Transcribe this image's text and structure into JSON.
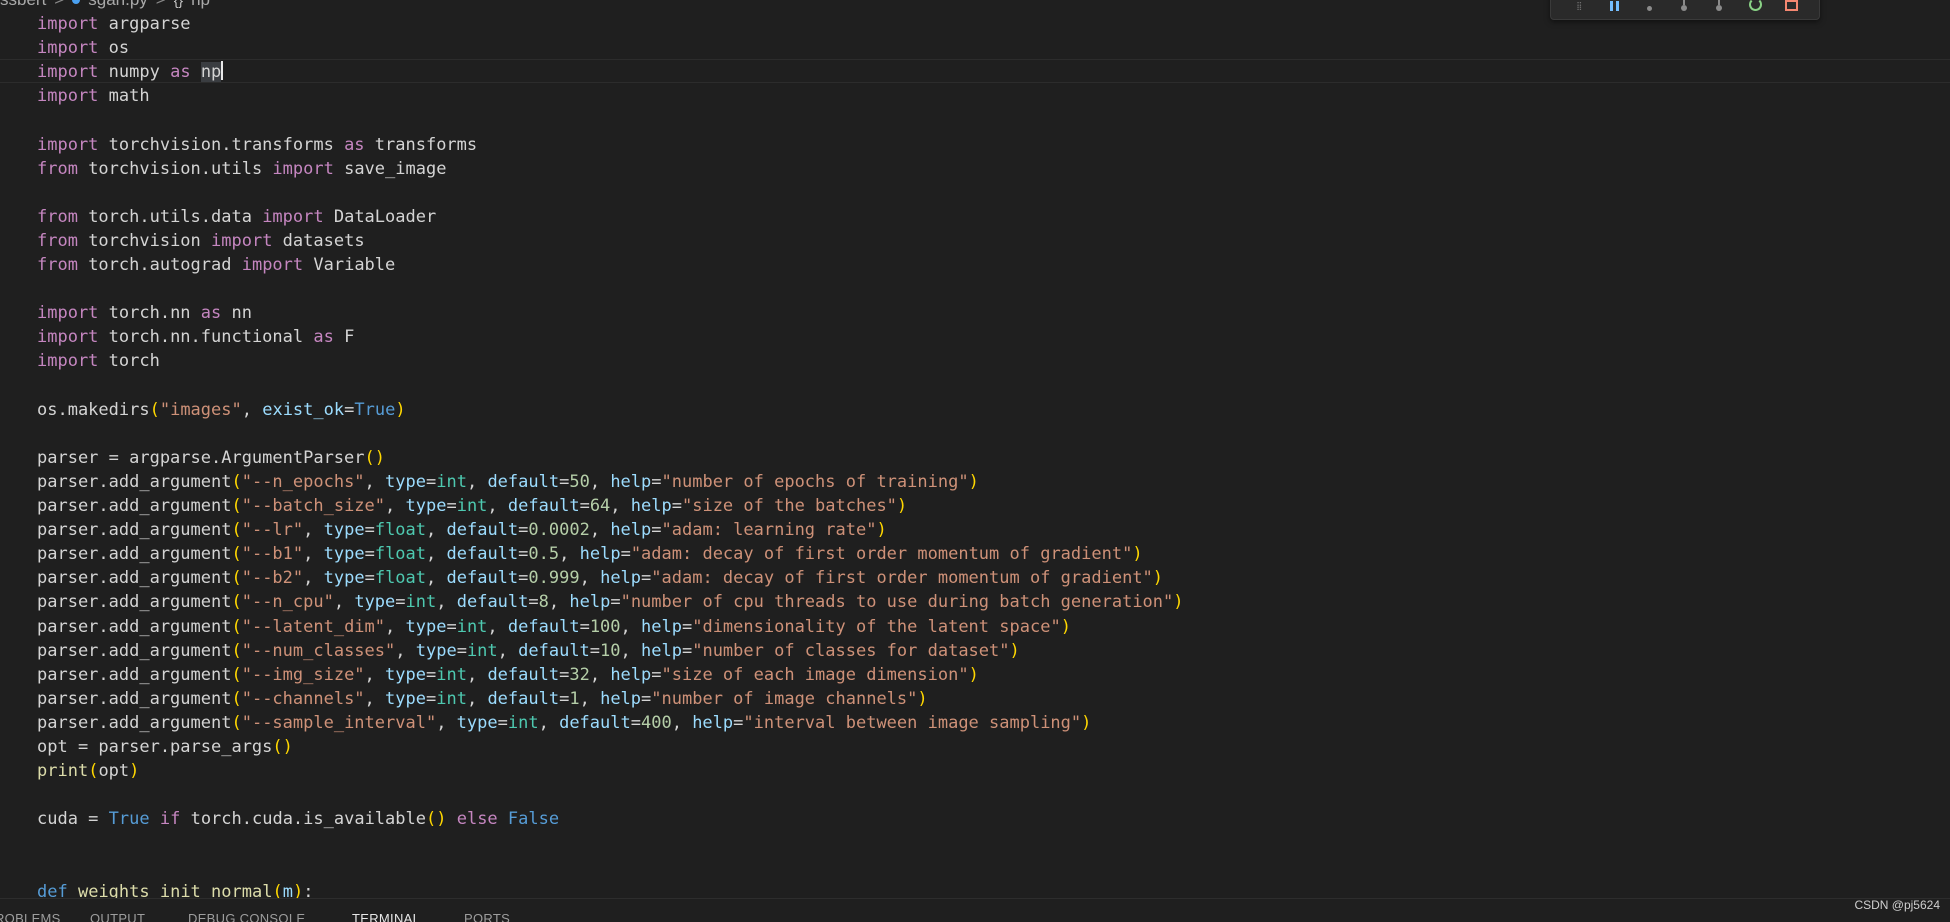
{
  "breadcrumb": {
    "folder": "ssbert",
    "file": "sgan.py",
    "symbol_icon": "{}",
    "symbol": "np",
    "separator": ">"
  },
  "debug_toolbar": {
    "buttons": [
      "drag-handle",
      "pause",
      "step-over",
      "step-into",
      "step-out",
      "restart",
      "stop"
    ]
  },
  "code_lines": [
    [
      [
        "kw",
        "import"
      ],
      [
        "plain",
        " argparse"
      ]
    ],
    [
      [
        "kw",
        "import"
      ],
      [
        "plain",
        " os"
      ]
    ],
    [
      [
        "kw",
        "import"
      ],
      [
        "plain",
        " numpy "
      ],
      [
        "kw",
        "as"
      ],
      [
        "plain",
        " "
      ],
      [
        "sel",
        "np"
      ],
      [
        "cursor",
        ""
      ]
    ],
    [
      [
        "kw",
        "import"
      ],
      [
        "plain",
        " math"
      ]
    ],
    [],
    [
      [
        "kw",
        "import"
      ],
      [
        "plain",
        " torchvision.transforms "
      ],
      [
        "kw",
        "as"
      ],
      [
        "plain",
        " transforms"
      ]
    ],
    [
      [
        "kw",
        "from"
      ],
      [
        "plain",
        " torchvision.utils "
      ],
      [
        "kw",
        "import"
      ],
      [
        "plain",
        " save_image"
      ]
    ],
    [],
    [
      [
        "kw",
        "from"
      ],
      [
        "plain",
        " torch.utils.data "
      ],
      [
        "kw",
        "import"
      ],
      [
        "plain",
        " DataLoader"
      ]
    ],
    [
      [
        "kw",
        "from"
      ],
      [
        "plain",
        " torchvision "
      ],
      [
        "kw",
        "import"
      ],
      [
        "plain",
        " datasets"
      ]
    ],
    [
      [
        "kw",
        "from"
      ],
      [
        "plain",
        " torch.autograd "
      ],
      [
        "kw",
        "import"
      ],
      [
        "plain",
        " Variable"
      ]
    ],
    [],
    [
      [
        "kw",
        "import"
      ],
      [
        "plain",
        " torch.nn "
      ],
      [
        "kw",
        "as"
      ],
      [
        "plain",
        " nn"
      ]
    ],
    [
      [
        "kw",
        "import"
      ],
      [
        "plain",
        " torch.nn.functional "
      ],
      [
        "kw",
        "as"
      ],
      [
        "plain",
        " F"
      ]
    ],
    [
      [
        "kw",
        "import"
      ],
      [
        "plain",
        " torch"
      ]
    ],
    [],
    [
      [
        "plain",
        "os.makedirs"
      ],
      [
        "paren",
        "("
      ],
      [
        "str",
        "\"images\""
      ],
      [
        "plain",
        ", "
      ],
      [
        "param",
        "exist_ok"
      ],
      [
        "plain",
        "="
      ],
      [
        "blue",
        "True"
      ],
      [
        "paren",
        ")"
      ]
    ],
    [],
    [
      [
        "plain",
        "parser = argparse.ArgumentParser"
      ],
      [
        "paren",
        "()"
      ]
    ],
    [
      [
        "plain",
        "parser.add_argument"
      ],
      [
        "paren",
        "("
      ],
      [
        "str",
        "\"--n_epochs\""
      ],
      [
        "plain",
        ", "
      ],
      [
        "param",
        "type"
      ],
      [
        "plain",
        "="
      ],
      [
        "type",
        "int"
      ],
      [
        "plain",
        ", "
      ],
      [
        "param",
        "default"
      ],
      [
        "plain",
        "="
      ],
      [
        "num",
        "50"
      ],
      [
        "plain",
        ", "
      ],
      [
        "param",
        "help"
      ],
      [
        "plain",
        "="
      ],
      [
        "str",
        "\"number of epochs of training\""
      ],
      [
        "paren",
        ")"
      ]
    ],
    [
      [
        "plain",
        "parser.add_argument"
      ],
      [
        "paren",
        "("
      ],
      [
        "str",
        "\"--batch_size\""
      ],
      [
        "plain",
        ", "
      ],
      [
        "param",
        "type"
      ],
      [
        "plain",
        "="
      ],
      [
        "type",
        "int"
      ],
      [
        "plain",
        ", "
      ],
      [
        "param",
        "default"
      ],
      [
        "plain",
        "="
      ],
      [
        "num",
        "64"
      ],
      [
        "plain",
        ", "
      ],
      [
        "param",
        "help"
      ],
      [
        "plain",
        "="
      ],
      [
        "str",
        "\"size of the batches\""
      ],
      [
        "paren",
        ")"
      ]
    ],
    [
      [
        "plain",
        "parser.add_argument"
      ],
      [
        "paren",
        "("
      ],
      [
        "str",
        "\"--lr\""
      ],
      [
        "plain",
        ", "
      ],
      [
        "param",
        "type"
      ],
      [
        "plain",
        "="
      ],
      [
        "type",
        "float"
      ],
      [
        "plain",
        ", "
      ],
      [
        "param",
        "default"
      ],
      [
        "plain",
        "="
      ],
      [
        "num",
        "0.0002"
      ],
      [
        "plain",
        ", "
      ],
      [
        "param",
        "help"
      ],
      [
        "plain",
        "="
      ],
      [
        "str",
        "\"adam: learning rate\""
      ],
      [
        "paren",
        ")"
      ]
    ],
    [
      [
        "plain",
        "parser.add_argument"
      ],
      [
        "paren",
        "("
      ],
      [
        "str",
        "\"--b1\""
      ],
      [
        "plain",
        ", "
      ],
      [
        "param",
        "type"
      ],
      [
        "plain",
        "="
      ],
      [
        "type",
        "float"
      ],
      [
        "plain",
        ", "
      ],
      [
        "param",
        "default"
      ],
      [
        "plain",
        "="
      ],
      [
        "num",
        "0.5"
      ],
      [
        "plain",
        ", "
      ],
      [
        "param",
        "help"
      ],
      [
        "plain",
        "="
      ],
      [
        "str",
        "\"adam: decay of first order momentum of gradient\""
      ],
      [
        "paren",
        ")"
      ]
    ],
    [
      [
        "plain",
        "parser.add_argument"
      ],
      [
        "paren",
        "("
      ],
      [
        "str",
        "\"--b2\""
      ],
      [
        "plain",
        ", "
      ],
      [
        "param",
        "type"
      ],
      [
        "plain",
        "="
      ],
      [
        "type",
        "float"
      ],
      [
        "plain",
        ", "
      ],
      [
        "param",
        "default"
      ],
      [
        "plain",
        "="
      ],
      [
        "num",
        "0.999"
      ],
      [
        "plain",
        ", "
      ],
      [
        "param",
        "help"
      ],
      [
        "plain",
        "="
      ],
      [
        "str",
        "\"adam: decay of first order momentum of gradient\""
      ],
      [
        "paren",
        ")"
      ]
    ],
    [
      [
        "plain",
        "parser.add_argument"
      ],
      [
        "paren",
        "("
      ],
      [
        "str",
        "\"--n_cpu\""
      ],
      [
        "plain",
        ", "
      ],
      [
        "param",
        "type"
      ],
      [
        "plain",
        "="
      ],
      [
        "type",
        "int"
      ],
      [
        "plain",
        ", "
      ],
      [
        "param",
        "default"
      ],
      [
        "plain",
        "="
      ],
      [
        "num",
        "8"
      ],
      [
        "plain",
        ", "
      ],
      [
        "param",
        "help"
      ],
      [
        "plain",
        "="
      ],
      [
        "str",
        "\"number of cpu threads to use during batch generation\""
      ],
      [
        "paren",
        ")"
      ]
    ],
    [
      [
        "plain",
        "parser.add_argument"
      ],
      [
        "paren",
        "("
      ],
      [
        "str",
        "\"--latent_dim\""
      ],
      [
        "plain",
        ", "
      ],
      [
        "param",
        "type"
      ],
      [
        "plain",
        "="
      ],
      [
        "type",
        "int"
      ],
      [
        "plain",
        ", "
      ],
      [
        "param",
        "default"
      ],
      [
        "plain",
        "="
      ],
      [
        "num",
        "100"
      ],
      [
        "plain",
        ", "
      ],
      [
        "param",
        "help"
      ],
      [
        "plain",
        "="
      ],
      [
        "str",
        "\"dimensionality of the latent space\""
      ],
      [
        "paren",
        ")"
      ]
    ],
    [
      [
        "plain",
        "parser.add_argument"
      ],
      [
        "paren",
        "("
      ],
      [
        "str",
        "\"--num_classes\""
      ],
      [
        "plain",
        ", "
      ],
      [
        "param",
        "type"
      ],
      [
        "plain",
        "="
      ],
      [
        "type",
        "int"
      ],
      [
        "plain",
        ", "
      ],
      [
        "param",
        "default"
      ],
      [
        "plain",
        "="
      ],
      [
        "num",
        "10"
      ],
      [
        "plain",
        ", "
      ],
      [
        "param",
        "help"
      ],
      [
        "plain",
        "="
      ],
      [
        "str",
        "\"number of classes for dataset\""
      ],
      [
        "paren",
        ")"
      ]
    ],
    [
      [
        "plain",
        "parser.add_argument"
      ],
      [
        "paren",
        "("
      ],
      [
        "str",
        "\"--img_size\""
      ],
      [
        "plain",
        ", "
      ],
      [
        "param",
        "type"
      ],
      [
        "plain",
        "="
      ],
      [
        "type",
        "int"
      ],
      [
        "plain",
        ", "
      ],
      [
        "param",
        "default"
      ],
      [
        "plain",
        "="
      ],
      [
        "num",
        "32"
      ],
      [
        "plain",
        ", "
      ],
      [
        "param",
        "help"
      ],
      [
        "plain",
        "="
      ],
      [
        "str",
        "\"size of each image dimension\""
      ],
      [
        "paren",
        ")"
      ]
    ],
    [
      [
        "plain",
        "parser.add_argument"
      ],
      [
        "paren",
        "("
      ],
      [
        "str",
        "\"--channels\""
      ],
      [
        "plain",
        ", "
      ],
      [
        "param",
        "type"
      ],
      [
        "plain",
        "="
      ],
      [
        "type",
        "int"
      ],
      [
        "plain",
        ", "
      ],
      [
        "param",
        "default"
      ],
      [
        "plain",
        "="
      ],
      [
        "num",
        "1"
      ],
      [
        "plain",
        ", "
      ],
      [
        "param",
        "help"
      ],
      [
        "plain",
        "="
      ],
      [
        "str",
        "\"number of image channels\""
      ],
      [
        "paren",
        ")"
      ]
    ],
    [
      [
        "plain",
        "parser.add_argument"
      ],
      [
        "paren",
        "("
      ],
      [
        "str",
        "\"--sample_interval\""
      ],
      [
        "plain",
        ", "
      ],
      [
        "param",
        "type"
      ],
      [
        "plain",
        "="
      ],
      [
        "type",
        "int"
      ],
      [
        "plain",
        ", "
      ],
      [
        "param",
        "default"
      ],
      [
        "plain",
        "="
      ],
      [
        "num",
        "400"
      ],
      [
        "plain",
        ", "
      ],
      [
        "param",
        "help"
      ],
      [
        "plain",
        "="
      ],
      [
        "str",
        "\"interval between image sampling\""
      ],
      [
        "paren",
        ")"
      ]
    ],
    [
      [
        "plain",
        "opt = parser.parse_args"
      ],
      [
        "paren",
        "()"
      ]
    ],
    [
      [
        "fn",
        "print"
      ],
      [
        "paren",
        "("
      ],
      [
        "plain",
        "opt"
      ],
      [
        "paren",
        ")"
      ]
    ],
    [],
    [
      [
        "plain",
        "cuda = "
      ],
      [
        "blue",
        "True"
      ],
      [
        "plain",
        " "
      ],
      [
        "kw",
        "if"
      ],
      [
        "plain",
        " torch.cuda.is_available"
      ],
      [
        "paren",
        "()"
      ],
      [
        "plain",
        " "
      ],
      [
        "kw",
        "else"
      ],
      [
        "plain",
        " "
      ],
      [
        "blue",
        "False"
      ]
    ],
    [],
    [],
    [
      [
        "blue",
        "def"
      ],
      [
        "plain",
        " "
      ],
      [
        "fn",
        "weights_init_normal"
      ],
      [
        "paren",
        "("
      ],
      [
        "param",
        "m"
      ],
      [
        "paren",
        ")"
      ],
      [
        "plain",
        ":"
      ]
    ]
  ],
  "panel_tabs": [
    {
      "label": "PROBLEMS",
      "active": false
    },
    {
      "label": "OUTPUT",
      "active": false
    },
    {
      "label": "DEBUG CONSOLE",
      "active": false
    },
    {
      "label": "TERMINAL",
      "active": true
    },
    {
      "label": "PORTS",
      "active": false
    }
  ],
  "watermark": "CSDN @pj5624",
  "colors": {
    "background": "#1f1f1f",
    "keyword": "#c586c0",
    "builtin_constant": "#569cd6",
    "function": "#dcdcaa",
    "string": "#ce9178",
    "number": "#b5cea8",
    "parameter": "#9cdcfe",
    "type": "#4ec9b0",
    "bracket": "#ffd700"
  }
}
